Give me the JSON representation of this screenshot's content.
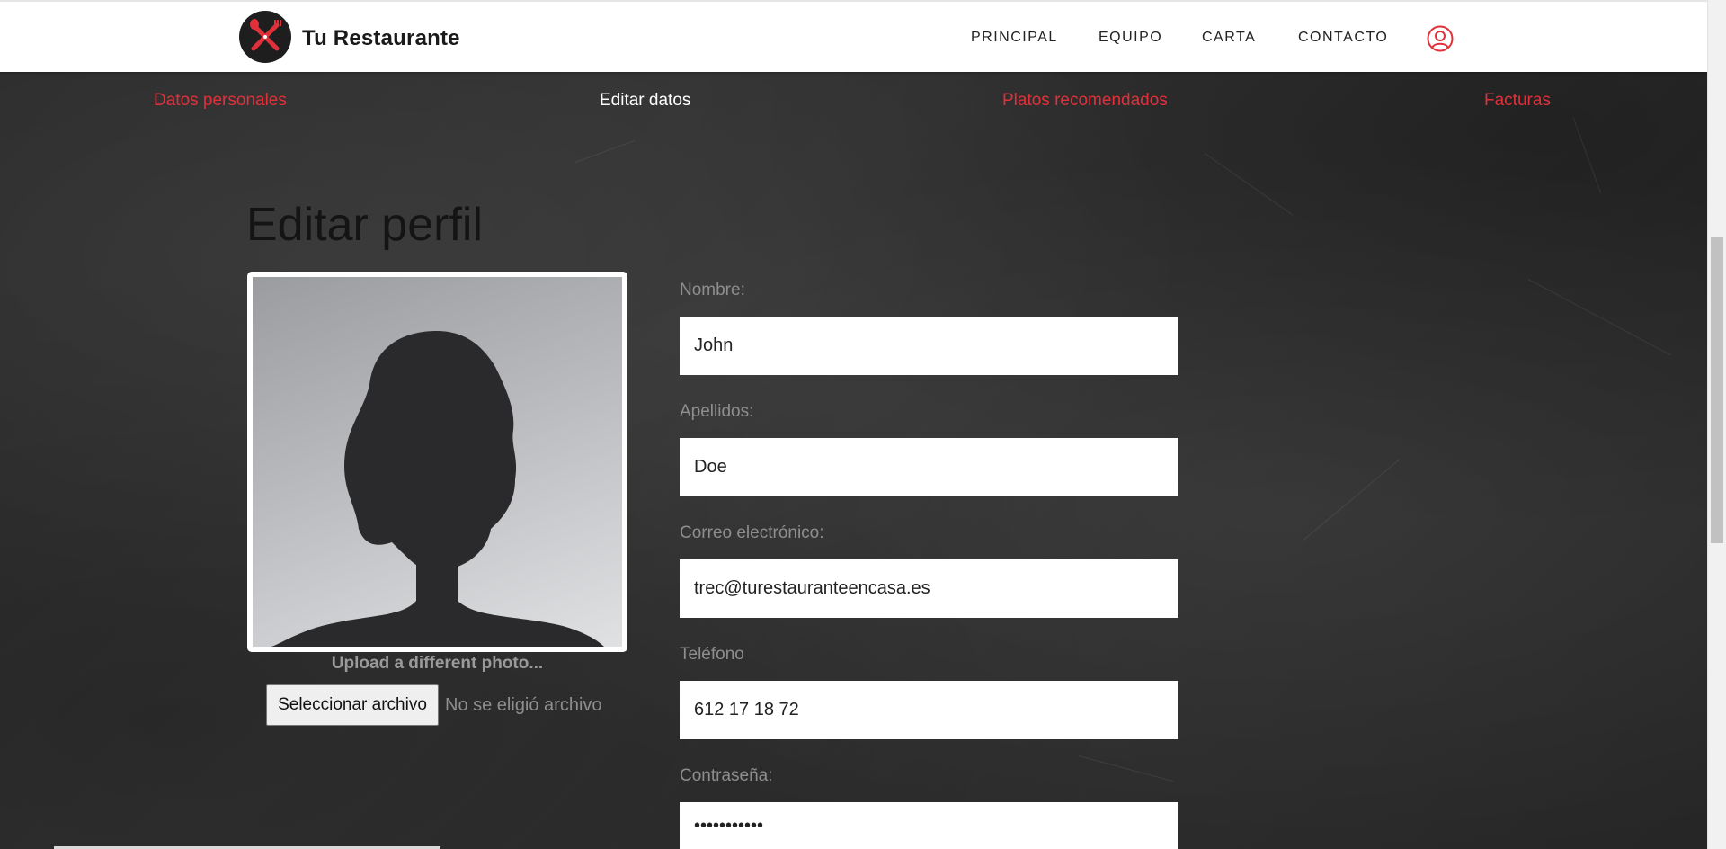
{
  "header": {
    "brand": "Tu Restaurante",
    "nav": [
      "PRINCIPAL",
      "EQUIPO",
      "CARTA",
      "CONTACTO"
    ]
  },
  "subnav": [
    "Datos personales",
    "Editar datos",
    "Platos recomendados",
    "Facturas"
  ],
  "main": {
    "title": "Editar perfil",
    "upload_text": "Upload a different photo...",
    "file_button": "Seleccionar archivo",
    "file_status": "No se eligió archivo"
  },
  "form": {
    "nombre_label": "Nombre:",
    "nombre_value": "John",
    "apellidos_label": "Apellidos:",
    "apellidos_value": "Doe",
    "correo_label": "Correo electrónico:",
    "correo_value": "trec@turestauranteencasa.es",
    "telefono_label": "Teléfono",
    "telefono_value": "612 17 18 72",
    "password_label": "Contraseña:",
    "password_value": "•••••••••••"
  },
  "colors": {
    "accent_red": "#e0313a",
    "active_subnav": "#ffffff",
    "background": "#2b2b2b"
  },
  "icons": {
    "logo": "restaurant-logo-icon",
    "user": "user-account-icon"
  }
}
